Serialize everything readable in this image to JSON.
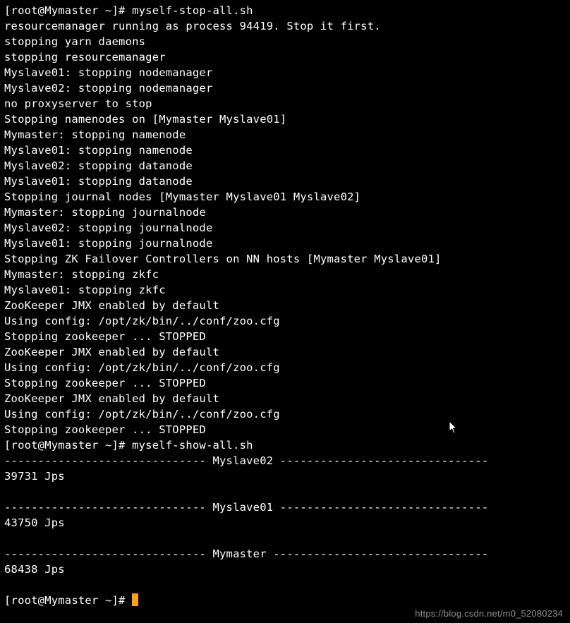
{
  "prompt1_prefix": "[root@Mymaster ~]# ",
  "cmd1": "myself-stop-all.sh",
  "out": [
    "resourcemanager running as process 94419. Stop it first.",
    "stopping yarn daemons",
    "stopping resourcemanager",
    "Myslave01: stopping nodemanager",
    "Myslave02: stopping nodemanager",
    "no proxyserver to stop",
    "Stopping namenodes on [Mymaster Myslave01]",
    "Mymaster: stopping namenode",
    "Myslave01: stopping namenode",
    "Myslave02: stopping datanode",
    "Myslave01: stopping datanode",
    "Stopping journal nodes [Mymaster Myslave01 Myslave02]",
    "Mymaster: stopping journalnode",
    "Myslave02: stopping journalnode",
    "Myslave01: stopping journalnode",
    "Stopping ZK Failover Controllers on NN hosts [Mymaster Myslave01]",
    "Mymaster: stopping zkfc",
    "Myslave01: stopping zkfc",
    "ZooKeeper JMX enabled by default",
    "Using config: /opt/zk/bin/../conf/zoo.cfg",
    "Stopping zookeeper ... STOPPED",
    "ZooKeeper JMX enabled by default",
    "Using config: /opt/zk/bin/../conf/zoo.cfg",
    "Stopping zookeeper ... STOPPED",
    "ZooKeeper JMX enabled by default",
    "Using config: /opt/zk/bin/../conf/zoo.cfg",
    "Stopping zookeeper ... STOPPED"
  ],
  "prompt2_prefix": "[root@Mymaster ~]# ",
  "cmd2": "myself-show-all.sh",
  "sep_slave02": "------------------------------ Myslave02 -------------------------------",
  "jps_slave02": "39731 Jps",
  "blank": "",
  "sep_slave01": "------------------------------ Myslave01 -------------------------------",
  "jps_slave01": "43750 Jps",
  "sep_master": "------------------------------ Mymaster --------------------------------",
  "jps_master": "68438 Jps",
  "prompt3_prefix": "[root@Mymaster ~]# ",
  "watermark": "https://blog.csdn.net/m0_52080234"
}
